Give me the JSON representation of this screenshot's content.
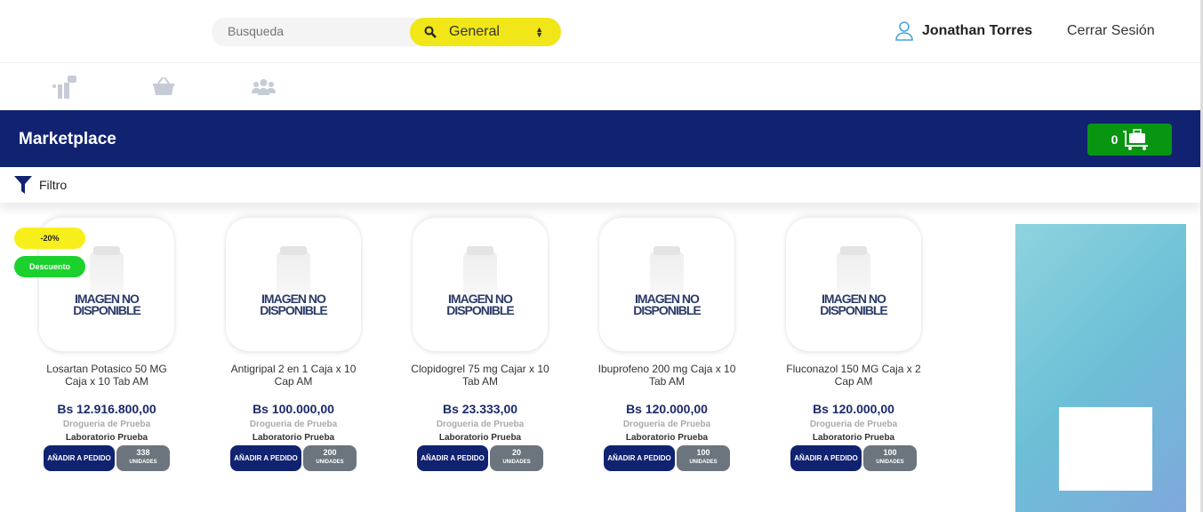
{
  "header": {
    "search_placeholder": "Busqueda",
    "category": "General",
    "user_name": "Jonathan Torres",
    "logout": "Cerrar Sesión"
  },
  "nav": {
    "icons": [
      "info-people-icon",
      "basket-icon",
      "users-icon"
    ]
  },
  "banner": {
    "title": "Marketplace",
    "cart_count": "0"
  },
  "filter": {
    "label": "Filtro"
  },
  "badges": {
    "discount_pct": "-20%",
    "discount_label": "Descuento"
  },
  "image_placeholder": {
    "line1": "IMAGEN NO",
    "line2": "DISPONIBLE"
  },
  "products": [
    {
      "name": "Losartan Potasico 50 MG Caja x 10 Tab AM",
      "price": "Bs 12.916.800,00",
      "store": "Drogueria de Prueba",
      "lab": "Laboratorio Prueba",
      "add": "AÑADIR A PEDIDO",
      "units": "338",
      "units_label": "UNIDADES"
    },
    {
      "name": "Antigripal 2 en 1 Caja x 10 Cap AM",
      "price": "Bs 100.000,00",
      "store": "Drogueria de Prueba",
      "lab": "Laboratorio Prueba",
      "add": "AÑADIR A PEDIDO",
      "units": "200",
      "units_label": "UNIDADES"
    },
    {
      "name": "Clopidogrel 75 mg Cajar x 10 Tab AM",
      "price": "Bs 23.333,00",
      "store": "Drogueria de Prueba",
      "lab": "Laboratorio Prueba",
      "add": "AÑADIR A PEDIDO",
      "units": "20",
      "units_label": "UNIDADES"
    },
    {
      "name": "Ibuprofeno 200 mg Caja x 10 Tab AM",
      "price": "Bs 120.000,00",
      "store": "Drogueria de Prueba",
      "lab": "Laboratorio Prueba",
      "add": "AÑADIR A PEDIDO",
      "units": "100",
      "units_label": "UNIDADES"
    },
    {
      "name": "Fluconazol 150 MG Caja x 2 Cap AM",
      "price": "Bs 120.000,00",
      "store": "Drogueria de Prueba",
      "lab": "Laboratorio Prueba",
      "add": "AÑADIR A PEDIDO",
      "units": "100",
      "units_label": "UNIDADES"
    }
  ]
}
